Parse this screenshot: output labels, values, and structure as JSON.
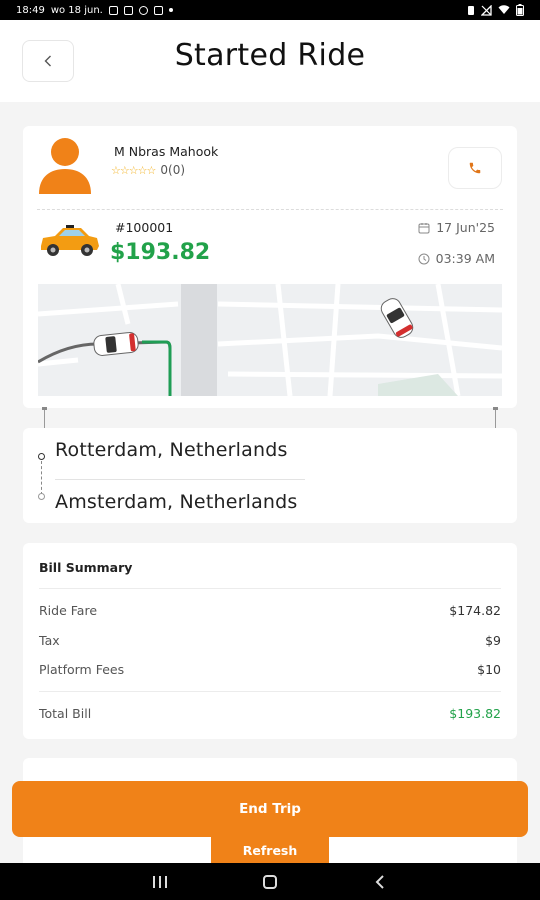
{
  "status_bar": {
    "time": "18:49",
    "date": "wo 18 jun.",
    "notification_icons": [
      "image-icon",
      "message-icon",
      "vpn-icon",
      "chat-icon"
    ],
    "system_icons": [
      "battery-saver-icon",
      "signal-off-icon",
      "wifi-icon",
      "battery-icon"
    ]
  },
  "header": {
    "back_icon": "chevron-left-icon",
    "title": "Started Ride"
  },
  "driver": {
    "name": "M Nbras Mahook",
    "stars_total": 5,
    "stars_filled": 0,
    "rating_text": "0(0)",
    "avatar_color": "#f08218",
    "call_icon": "phone-icon"
  },
  "ride": {
    "id": "#100001",
    "price": "$193.82",
    "date": "17 Jun'25",
    "time": "03:39 AM",
    "car_icon": "taxi-car-icon",
    "price_color": "#22a24a"
  },
  "route": {
    "from": "Rotterdam, Netherlands",
    "to": "Amsterdam, Netherlands"
  },
  "bill": {
    "title": "Bill Summary",
    "rows": [
      {
        "label": "Ride Fare",
        "value": "$174.82"
      },
      {
        "label": "Tax",
        "value": "$9"
      },
      {
        "label": "Platform Fees",
        "value": "$10"
      }
    ],
    "total_label": "Total Bill",
    "total_value": "$193.82"
  },
  "actions": {
    "end_trip": "End Trip",
    "refresh": "Refresh",
    "accent_color": "#f08218"
  },
  "nav_bar": {
    "icons": [
      "recents-icon",
      "home-icon",
      "back-icon"
    ]
  }
}
